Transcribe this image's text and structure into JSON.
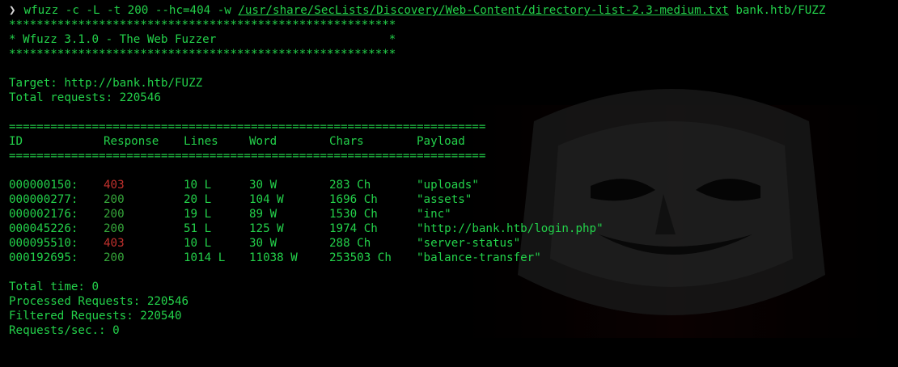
{
  "terminal": {
    "prompt_symbol": "❯",
    "command_prefix": "wfuzz -c -L -t 200 --hc=404 -w ",
    "command_wordlist": "/usr/share/SecLists/Discovery/Web-Content/directory-list-2.3-medium.txt",
    "command_suffix": " bank.htb/FUZZ",
    "banner": [
      "********************************************************",
      "* Wfuzz 3.1.0 - The Web Fuzzer                         *",
      "********************************************************"
    ],
    "target_line": "Target: http://bank.htb/FUZZ",
    "total_requests_line": "Total requests: 220546",
    "separator": "=====================================================================",
    "headers": {
      "id": "ID",
      "response": "Response",
      "lines": "Lines",
      "word": "Word",
      "chars": "Chars",
      "payload": "Payload"
    },
    "results": [
      {
        "id": "000000150:",
        "response": "403",
        "lines": "10 L",
        "word": "30 W",
        "chars": "283 Ch",
        "payload": "\"uploads\""
      },
      {
        "id": "000000277:",
        "response": "200",
        "lines": "20 L",
        "word": "104 W",
        "chars": "1696 Ch",
        "payload": "\"assets\""
      },
      {
        "id": "000002176:",
        "response": "200",
        "lines": "19 L",
        "word": "89 W",
        "chars": "1530 Ch",
        "payload": "\"inc\""
      },
      {
        "id": "000045226:",
        "response": "200",
        "lines": "51 L",
        "word": "125 W",
        "chars": "1974 Ch",
        "payload": "\"http://bank.htb/login.php\""
      },
      {
        "id": "000095510:",
        "response": "403",
        "lines": "10 L",
        "word": "30 W",
        "chars": "288 Ch",
        "payload": "\"server-status\""
      },
      {
        "id": "000192695:",
        "response": "200",
        "lines": "1014 L",
        "word": "11038 W",
        "chars": "253503 Ch",
        "payload": "\"balance-transfer\""
      }
    ],
    "summary": {
      "total_time": "Total time: 0",
      "processed": "Processed Requests: 220546",
      "filtered": "Filtered Requests: 220540",
      "rate": "Requests/sec.: 0"
    }
  },
  "colors": {
    "background": "#000000",
    "text_green": "#23d14a",
    "status_403": "#c2312d",
    "status_200": "#35a63a"
  }
}
